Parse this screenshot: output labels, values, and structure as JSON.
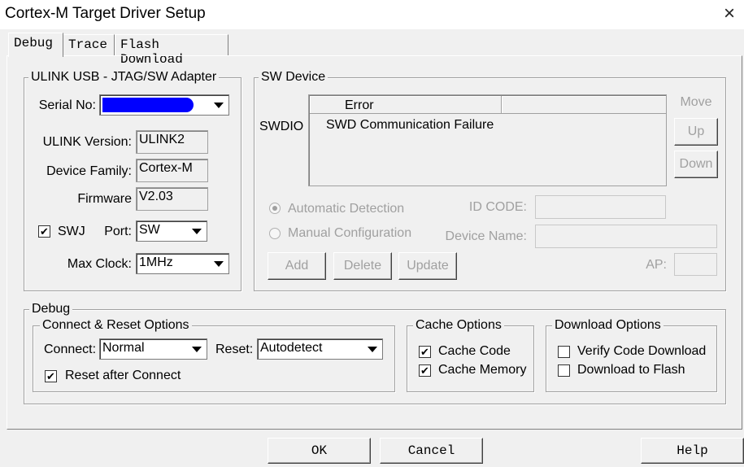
{
  "window": {
    "title": "Cortex-M Target Driver Setup",
    "close_glyph": "×"
  },
  "tabs": [
    {
      "label": "Debug",
      "active": true
    },
    {
      "label": "Trace",
      "active": false
    },
    {
      "label": "Flash Download",
      "active": false
    }
  ],
  "adapter": {
    "group_title": "ULINK USB - JTAG/SW Adapter",
    "serial_label": "Serial No:",
    "serial_value": "(redacted)",
    "ulink_version_label": "ULINK Version:",
    "ulink_version_value": "ULINK2",
    "device_family_label": "Device Family:",
    "device_family_value": "Cortex-M",
    "firmware_label": "Firmware",
    "firmware_value": "V2.03",
    "swj_label": "SWJ",
    "swj_checked": true,
    "port_label": "Port:",
    "port_value": "SW",
    "max_clock_label": "Max Clock:",
    "max_clock_value": "1MHz"
  },
  "sw_device": {
    "group_title": "SW Device",
    "swdio_label": "SWDIO",
    "column_header": "Error",
    "row_text": "SWD Communication Failure",
    "move_label": "Move",
    "up_label": "Up",
    "down_label": "Down",
    "auto_detect_label": "Automatic Detection",
    "manual_config_label": "Manual Configuration",
    "id_code_label": "ID CODE:",
    "device_name_label": "Device Name:",
    "ap_label": "AP:",
    "add_label": "Add",
    "delete_label": "Delete",
    "update_label": "Update"
  },
  "debug": {
    "group_title": "Debug",
    "connect_reset": {
      "group_title": "Connect & Reset Options",
      "connect_label": "Connect:",
      "connect_value": "Normal",
      "reset_label": "Reset:",
      "reset_value": "Autodetect",
      "reset_after_connect_label": "Reset after Connect",
      "reset_after_connect_checked": true
    },
    "cache": {
      "group_title": "Cache Options",
      "cache_code_label": "Cache Code",
      "cache_code_checked": true,
      "cache_memory_label": "Cache Memory",
      "cache_memory_checked": true
    },
    "download": {
      "group_title": "Download Options",
      "verify_label": "Verify Code Download",
      "verify_checked": false,
      "download_flash_label": "Download to Flash",
      "download_flash_checked": false
    }
  },
  "footer": {
    "ok_label": "OK",
    "cancel_label": "Cancel",
    "help_label": "Help"
  },
  "colors": {
    "disabled_text": "#a0a0a0",
    "redaction_blue": "#0000ff",
    "dialog_bg": "#f0f0f0"
  },
  "icons": {
    "check": "✔",
    "close": "close-icon",
    "dropdown": "chevron-down-icon"
  }
}
